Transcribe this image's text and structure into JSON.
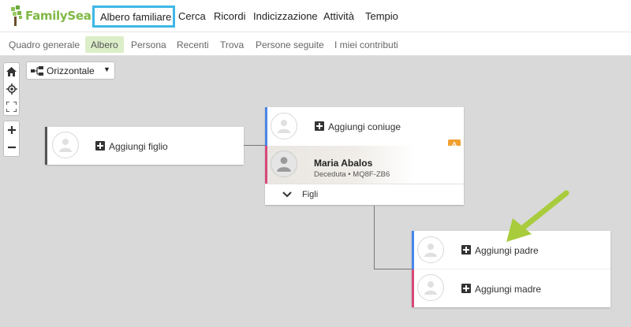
{
  "brand": {
    "logo_text": "FamilySearch",
    "primary_color": "#7fb844",
    "highlight_color": "#3fb7e6"
  },
  "topnav": {
    "active": "Albero familiare",
    "items": [
      "Cerca",
      "Ricordi",
      "Indicizzazione",
      "Attività",
      "Tempio"
    ]
  },
  "subnav": {
    "items": [
      "Quadro generale",
      "Albero",
      "Persona",
      "Recenti",
      "Trova",
      "Persone seguite",
      "I miei contributi"
    ]
  },
  "toolbar": {
    "orientation_label": "Orizzontale",
    "orientation_icon": "tree-layout-icon"
  },
  "tree": {
    "child_card": {
      "add_label": "Aggiungi figlio"
    },
    "couple_card": {
      "add_spouse_label": "Aggiungi coniuge",
      "person_name": "Maria Abalos",
      "person_status": "Deceduta",
      "person_id": "MQ8F-ZB6",
      "children_label": "Figli"
    },
    "parents_card": {
      "add_father_label": "Aggiungi padre",
      "add_mother_label": "Aggiungi madre"
    }
  },
  "colors": {
    "male": "#4a86e8",
    "female": "#d9487a",
    "alert": "#f0a030",
    "arrow": "#a8cc3c",
    "connector": "#777777"
  }
}
